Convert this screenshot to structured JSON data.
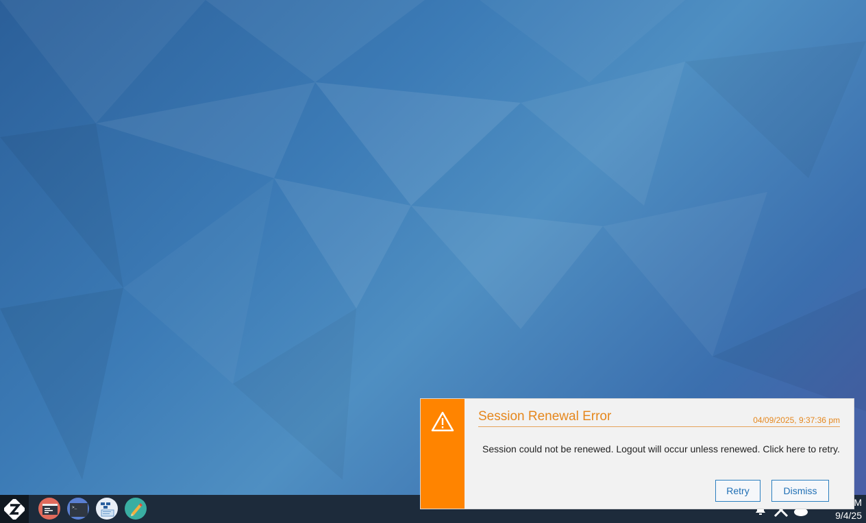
{
  "desktop": {
    "wallpaper": "blue-low-poly",
    "accent_colors": [
      "#2b5f99",
      "#4f8fc2",
      "#4b5ea6"
    ]
  },
  "taskbar": {
    "start_icon": "z-logo-icon",
    "launchers": [
      {
        "name": "terminal-app",
        "icon": "terminal-icon",
        "color": "#e16b5c"
      },
      {
        "name": "console-app",
        "icon": "console-icon",
        "color": "#5a7fd1"
      },
      {
        "name": "network-app",
        "icon": "network-icon",
        "color": "#e8eef6"
      },
      {
        "name": "editor-app",
        "icon": "pencil-icon",
        "color": "#3aaea2"
      }
    ],
    "tray": {
      "icons": [
        "bell-icon",
        "tools-icon",
        "cloud-icon"
      ],
      "clock_time_partial": "M",
      "clock_date": "9/4/25"
    }
  },
  "notification": {
    "title": "Session Renewal Error",
    "timestamp": "04/09/2025, 9:37:36 pm",
    "message": "Session could not be renewed. Logout will occur unless renewed. Click here to retry.",
    "icon": "warning-icon",
    "accent_color": "#ff8400",
    "buttons": {
      "retry": "Retry",
      "dismiss": "Dismiss"
    }
  }
}
